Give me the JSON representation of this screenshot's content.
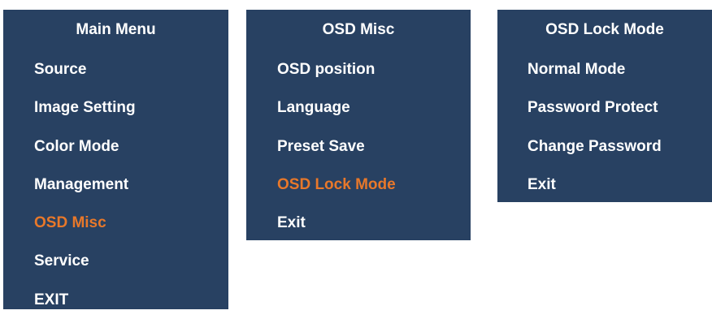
{
  "colors": {
    "panel_bg": "#284162",
    "text": "#ffffff",
    "highlight": "#e8782a"
  },
  "main_menu": {
    "title": "Main Menu",
    "items": [
      {
        "label": "Source",
        "active": false
      },
      {
        "label": "Image Setting",
        "active": false
      },
      {
        "label": "Color Mode",
        "active": false
      },
      {
        "label": "Management",
        "active": false
      },
      {
        "label": "OSD Misc",
        "active": true
      },
      {
        "label": "Service",
        "active": false
      },
      {
        "label": "EXIT",
        "active": false
      }
    ]
  },
  "osd_misc": {
    "title": "OSD Misc",
    "items": [
      {
        "label": "OSD position",
        "active": false
      },
      {
        "label": "Language",
        "active": false
      },
      {
        "label": "Preset Save",
        "active": false
      },
      {
        "label": "OSD Lock Mode",
        "active": true
      },
      {
        "label": "Exit",
        "active": false
      }
    ]
  },
  "osd_lock_mode": {
    "title": "OSD Lock Mode",
    "items": [
      {
        "label": "Normal Mode",
        "active": false
      },
      {
        "label": "Password Protect",
        "active": false
      },
      {
        "label": "Change Password",
        "active": false
      },
      {
        "label": "Exit",
        "active": false
      }
    ]
  }
}
